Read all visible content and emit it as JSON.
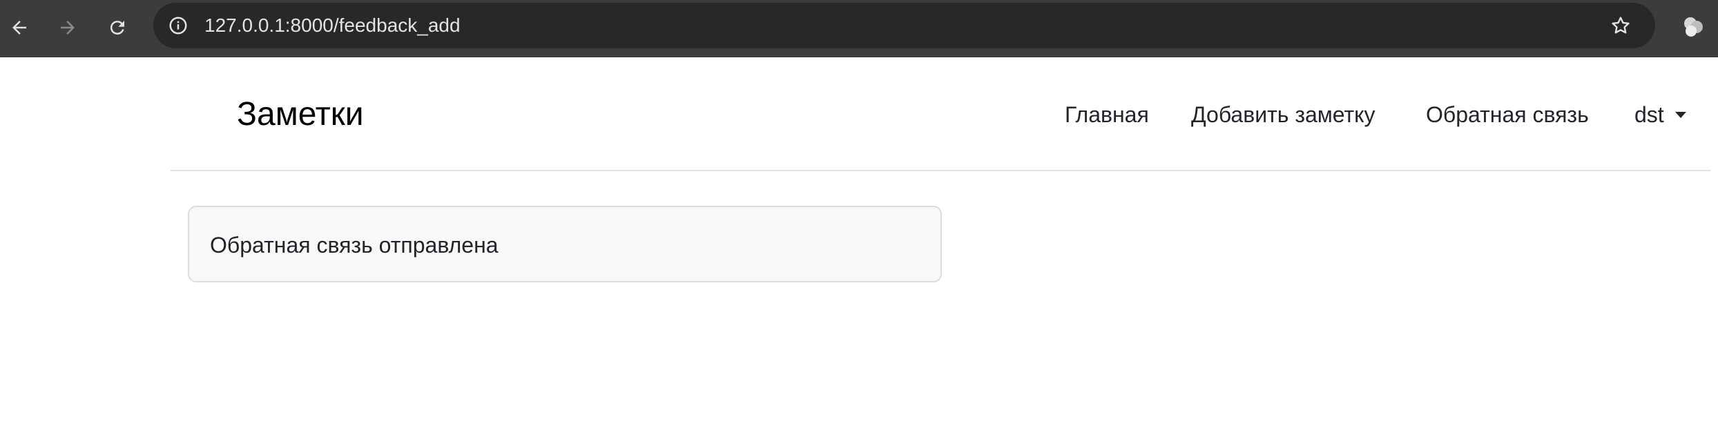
{
  "browser": {
    "url": "127.0.0.1:8000/feedback_add",
    "icons": [
      "back-arrow-icon",
      "forward-arrow-icon",
      "reload-icon",
      "site-info-icon",
      "bookmark-star-icon",
      "profile-icon"
    ]
  },
  "navbar": {
    "brand": "Заметки",
    "links": [
      "Главная",
      "Добавить заметку",
      "Обратная связь"
    ],
    "user": "dst"
  },
  "main": {
    "message": "Обратная связь отправлена"
  },
  "colors": {
    "browser_bar": "#3c3c3c",
    "omnibox": "#282828",
    "alert_bg": "#f8f8f8",
    "alert_border": "#dcdcdc",
    "text": "#212529"
  }
}
